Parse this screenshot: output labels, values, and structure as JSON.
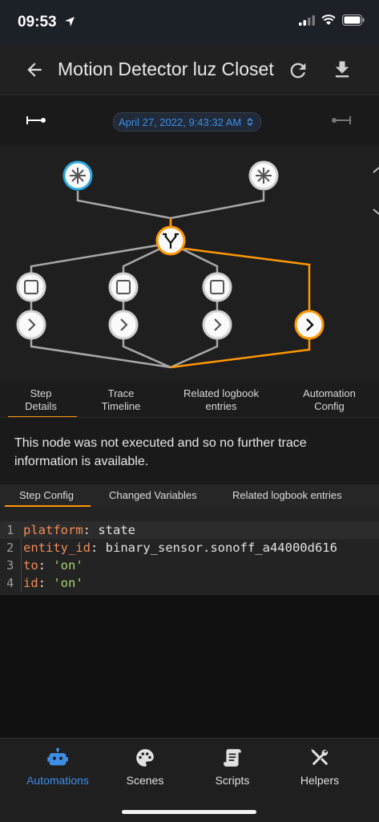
{
  "status_bar": {
    "time": "09:53"
  },
  "app_bar": {
    "title": "Motion Detector luz Closet"
  },
  "toolbar": {
    "timestamp": "April 27, 2022, 9:43:32 AM"
  },
  "trace_tabs": [
    {
      "label": "Step\nDetails",
      "active": true
    },
    {
      "label": "Trace\nTimeline",
      "active": false
    },
    {
      "label": "Related logbook\nentries",
      "active": false
    },
    {
      "label": "Automation\nConfig",
      "active": false
    }
  ],
  "notice": {
    "text": "This node was not executed and so no further trace information is available."
  },
  "detail_tabs": [
    {
      "label": "Step Config",
      "active": true
    },
    {
      "label": "Changed Variables",
      "active": false
    },
    {
      "label": "Related logbook entries",
      "active": false
    }
  ],
  "code": [
    {
      "line": "1",
      "key": "platform",
      "value": "state",
      "value_type": "plain"
    },
    {
      "line": "2",
      "key": "entity_id",
      "value": "binary_sensor.sonoff_a44000d616",
      "value_type": "plain"
    },
    {
      "line": "3",
      "key": "to",
      "value": "'on'",
      "value_type": "string"
    },
    {
      "line": "4",
      "key": "id",
      "value": "'on'",
      "value_type": "string"
    }
  ],
  "bottom_nav": [
    {
      "label": "Automations",
      "icon": "robot-icon",
      "active": true
    },
    {
      "label": "Scenes",
      "icon": "palette-icon",
      "active": false
    },
    {
      "label": "Scripts",
      "icon": "script-icon",
      "active": false
    },
    {
      "label": "Helpers",
      "icon": "tools-icon",
      "active": false
    }
  ],
  "colors": {
    "accent": "#3f8ee6",
    "active_path": "#ff9800",
    "yaml_key": "#f28b58",
    "yaml_string": "#a6d46f"
  }
}
